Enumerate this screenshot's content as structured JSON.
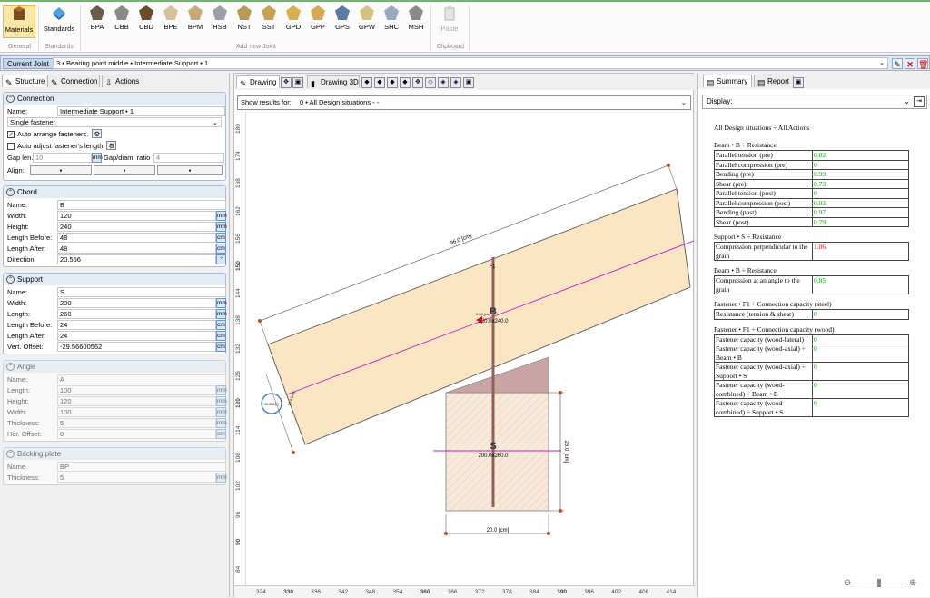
{
  "ribbon": {
    "general": {
      "materials": "Materials",
      "group": "General"
    },
    "standards": {
      "standards": "Standards",
      "group": "Standards"
    },
    "joints": [
      "BPA",
      "CBB",
      "CBD",
      "BPE",
      "BPM",
      "HSB",
      "NST",
      "SST",
      "GPD",
      "GPP",
      "GPS",
      "GPW",
      "SHC",
      "MSH"
    ],
    "add_group": "Add new Joint",
    "paste": "Paste",
    "clipboard_group": "Clipboard"
  },
  "joint_bar": {
    "label": "Current Joint",
    "value": "3  •  Bearing point middle  •  Intermediate Support • 1"
  },
  "left_tabs": [
    "Structure",
    "Connection",
    "Actions"
  ],
  "connection": {
    "title": "Connection",
    "name_label": "Name:",
    "name": "Intermediate Support • 1",
    "fastener_mode": "Single fastener",
    "auto_arrange": "Auto arrange fasteners.",
    "auto_adjust": "Auto adjust fastener's length",
    "gap_len_label": "Gap len.",
    "gap_len": "10",
    "gap_unit": "mm",
    "gap_ratio_label": "Gap/diam. ratio",
    "gap_ratio": "4",
    "align_label": "Align:"
  },
  "chord": {
    "title": "Chord",
    "rows": [
      {
        "label": "Name:",
        "value": "B",
        "unit": ""
      },
      {
        "label": "Width:",
        "value": "120",
        "unit": "mm"
      },
      {
        "label": "Height:",
        "value": "240",
        "unit": "mm"
      },
      {
        "label": "Length Before:",
        "value": "48",
        "unit": "cm"
      },
      {
        "label": "Length After:",
        "value": "48",
        "unit": "cm"
      },
      {
        "label": "Direction:",
        "value": "20.556",
        "unit": "°"
      }
    ]
  },
  "support": {
    "title": "Support",
    "rows": [
      {
        "label": "Name:",
        "value": "S",
        "unit": ""
      },
      {
        "label": "Width:",
        "value": "200",
        "unit": "mm"
      },
      {
        "label": "Length:",
        "value": "260",
        "unit": "mm"
      },
      {
        "label": "Length Before:",
        "value": "24",
        "unit": "cm"
      },
      {
        "label": "Length After:",
        "value": "24",
        "unit": "cm"
      },
      {
        "label": "Vert. Offset:",
        "value": "-29.56600562",
        "unit": "cm"
      }
    ]
  },
  "angle": {
    "title": "Angle",
    "rows": [
      {
        "label": "Name:",
        "value": "A",
        "unit": ""
      },
      {
        "label": "Length:",
        "value": "100",
        "unit": "mm"
      },
      {
        "label": "Height:",
        "value": "120",
        "unit": "mm"
      },
      {
        "label": "Width:",
        "value": "100",
        "unit": "mm"
      },
      {
        "label": "Thickness:",
        "value": "5",
        "unit": "mm"
      },
      {
        "label": "Hor. Offset:",
        "value": "0",
        "unit": "cm"
      }
    ]
  },
  "backing": {
    "title": "Backing plate",
    "rows": [
      {
        "label": "Name",
        "value": "BP",
        "unit": ""
      },
      {
        "label": "Thickness:",
        "value": "5",
        "unit": "mm"
      }
    ]
  },
  "mid_tabs": {
    "drawing": "Drawing",
    "drawing3d": "Drawing 3D"
  },
  "show_results": {
    "label": "Show results for:",
    "value": "0  •  All Design situations  -  -"
  },
  "drawing": {
    "dim_top": "96.0 [cm]",
    "dim_bottom": "20.0 [cm]",
    "dim_right": "26.0 [cm]",
    "beam_label": "B",
    "beam_size": "120.0x240.0",
    "support_label": "S",
    "support_size": "200.0x260.0",
    "fastener_label": "F1",
    "small1": "0.00 [cm]",
    "small2": "10.0 [cm]",
    "small3": "20.556 [°]"
  },
  "v_ruler": [
    "180",
    "174",
    "168",
    "162",
    "156",
    "150",
    "144",
    "138",
    "132",
    "126",
    "120",
    "114",
    "108",
    "102",
    "96",
    "90",
    "84"
  ],
  "h_ruler": [
    "324",
    "330",
    "336",
    "342",
    "348",
    "354",
    "360",
    "366",
    "372",
    "378",
    "384",
    "390",
    "396",
    "402",
    "408",
    "414"
  ],
  "right_tabs": {
    "summary": "Summary",
    "report": "Report"
  },
  "display_label": "Display:",
  "report": {
    "heading": "All Design situations ÷ All Actions",
    "sections": [
      {
        "title": "Beam • B ÷ Resistance",
        "rows": [
          {
            "name": "Parallel tension (pre)",
            "value": "0.02",
            "status": "ok"
          },
          {
            "name": "Parallel compression (pre)",
            "value": "0",
            "status": "ok"
          },
          {
            "name": "Bending (pre)",
            "value": "0.99",
            "status": "ok"
          },
          {
            "name": "Shear (pre)",
            "value": "0.73",
            "status": "ok"
          },
          {
            "name": "Parallel tension (post)",
            "value": "0",
            "status": "ok"
          },
          {
            "name": "Parallel compression (post)",
            "value": "0.02",
            "status": "ok"
          },
          {
            "name": "Bending (post)",
            "value": "0.97",
            "status": "ok"
          },
          {
            "name": "Shear (post)",
            "value": "0.79",
            "status": "ok"
          }
        ]
      },
      {
        "title": "Support • S ÷ Resistance",
        "rows": [
          {
            "name": "Compression perpendicular to the grain",
            "value": "1.06",
            "status": "bad"
          }
        ]
      },
      {
        "title": "Beam • B ÷ Resistance",
        "rows": [
          {
            "name": "Compression at an angle to the grain",
            "value": "0.85",
            "status": "ok"
          }
        ]
      },
      {
        "title": "Fastener • F1 ÷ Connection capacity (steel)",
        "rows": [
          {
            "name": "Resistance (tension & shear)",
            "value": "0",
            "status": "ok"
          }
        ]
      },
      {
        "title": "Fastener • F1 ÷ Connection capacity (wood)",
        "rows": [
          {
            "name": "Fastener capacity (wood-lateral)",
            "value": "0",
            "status": "ok"
          },
          {
            "name": "Fastener capacity (wood-axial) ÷ Beam • B",
            "value": "0",
            "status": "ok"
          },
          {
            "name": "Fastener capacity (wood-axial) ÷ Support • S",
            "value": "0",
            "status": "ok"
          },
          {
            "name": "Fastener capacity (wood-combined) ÷ Beam • B",
            "value": "0",
            "status": "ok"
          },
          {
            "name": "Fastener capacity (wood-combined) ÷ Support • S",
            "value": "0",
            "status": "ok"
          }
        ]
      }
    ]
  },
  "colors": {
    "ok": "#139a13",
    "bad": "#d21212",
    "beam": "#fbe6c4",
    "support": "#f7eadc",
    "accent": "#2e6bc6"
  }
}
